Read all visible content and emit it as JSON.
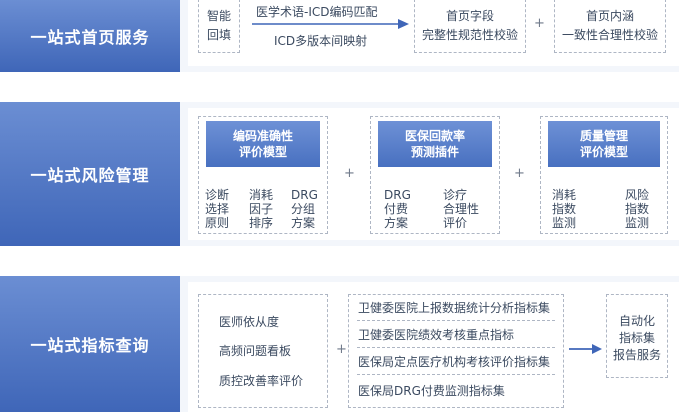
{
  "sections": {
    "homepage": {
      "label": "一站式首页服务"
    },
    "risk": {
      "label": "一站式风险管理"
    },
    "indicator": {
      "label": "一站式指标查询"
    }
  },
  "homepage": {
    "smart_fill": {
      "line1": "智能",
      "line2": "回填"
    },
    "mapping": {
      "top": "医学术语-ICD编码匹配",
      "bottom": "ICD多版本间映射"
    },
    "field_box": {
      "line1": "首页字段",
      "line2": "完整性规范性校验"
    },
    "plus": "+",
    "content_box": {
      "line1": "首页内涵",
      "line2": "一致性合理性校验"
    }
  },
  "risk": {
    "models": [
      {
        "title_line1": "编码准确性",
        "title_line2": "评价模型",
        "cols": [
          [
            "诊断",
            "选择",
            "原则"
          ],
          [
            "消耗",
            "因子",
            "排序"
          ],
          [
            "DRG",
            "分组",
            "方案"
          ]
        ]
      },
      {
        "title_line1": "医保回款率",
        "title_line2": "预测插件",
        "cols": [
          [
            "DRG",
            "付费",
            "方案"
          ],
          [
            "诊疗",
            "合理性",
            "评价"
          ]
        ]
      },
      {
        "title_line1": "质量管理",
        "title_line2": "评价模型",
        "cols": [
          [
            "消耗",
            "指数",
            "监测"
          ],
          [
            "风险",
            "指数",
            "监测"
          ]
        ]
      }
    ],
    "plus": "+"
  },
  "indicator": {
    "left_items": [
      "医师依从度",
      "高频问题看板",
      "质控改善率评价"
    ],
    "plus": "+",
    "sets": [
      "卫健委医院上报数据统计分析指标集",
      "卫健委医院绩效考核重点指标",
      "医保局定点医疗机构考核评价指标集",
      "医保局DRG付费监测指标集"
    ],
    "output": {
      "line1": "自动化",
      "line2": "指标集",
      "line3": "报告服务"
    }
  },
  "colors": {
    "accent": "#4a72c2",
    "background_tint": "#f3f6fb"
  }
}
